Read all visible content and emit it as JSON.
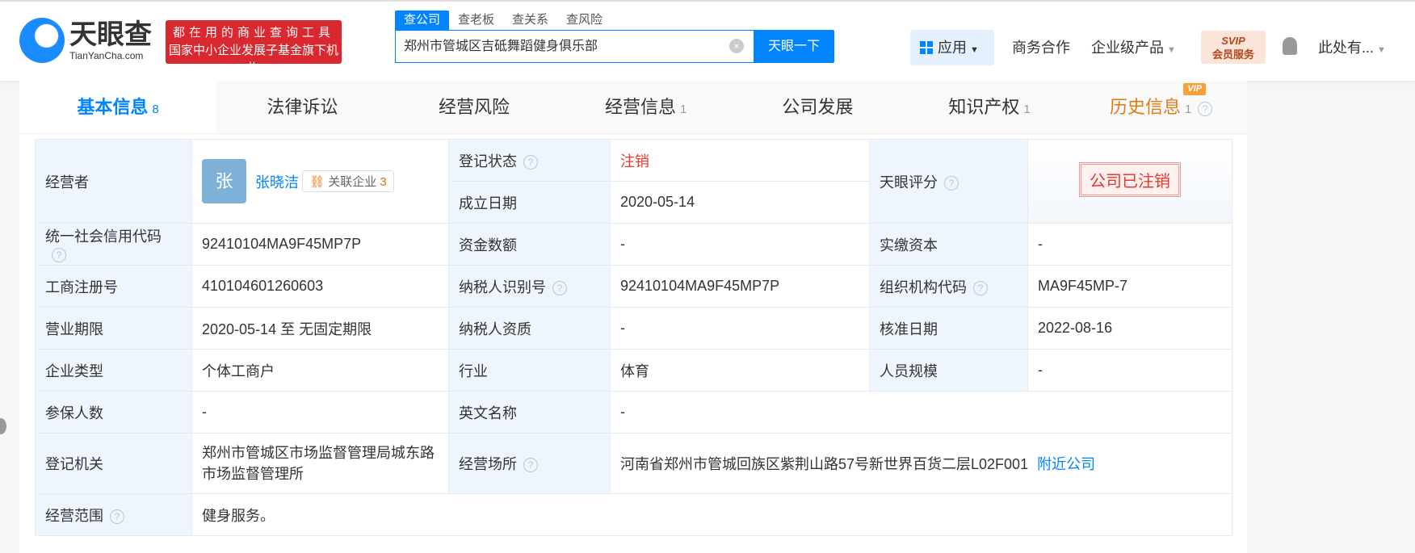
{
  "header": {
    "logo_cn": "天眼查",
    "logo_en": "TianYanCha.com",
    "slogan_line1": "都在用的商业查询工具",
    "slogan_line2": "国家中小企业发展子基金旗下机构",
    "search_tabs": [
      "查公司",
      "查老板",
      "查关系",
      "查风险"
    ],
    "search_value": "郑州市管城区吉砥舞蹈健身俱乐部",
    "search_button": "天眼一下",
    "nav": {
      "app": "应用",
      "business": "商务合作",
      "enterprise": "企业级产品",
      "svip_top": "SVIP",
      "svip_bottom": "会员服务",
      "user": "此处有..."
    }
  },
  "tabs": [
    {
      "label": "基本信息",
      "count": "8"
    },
    {
      "label": "法律诉讼",
      "count": ""
    },
    {
      "label": "经营风险",
      "count": ""
    },
    {
      "label": "经营信息",
      "count": "1"
    },
    {
      "label": "公司发展",
      "count": ""
    },
    {
      "label": "知识产权",
      "count": "1"
    },
    {
      "label": "历史信息",
      "count": "1",
      "badge": "VIP"
    }
  ],
  "info": {
    "operator_label": "经营者",
    "operator_avatar": "张",
    "operator_name": "张晓洁",
    "related_label": "关联企业",
    "related_count": "3",
    "status_label": "登记状态",
    "status_value": "注销",
    "founded_label": "成立日期",
    "founded_value": "2020-05-14",
    "score_label": "天眼评分",
    "score_stamp": "公司已注销",
    "credit_code_label": "统一社会信用代码",
    "credit_code_value": "92410104MA9F45MP7P",
    "capital_label": "资金数额",
    "capital_value": "-",
    "paid_label": "实缴资本",
    "paid_value": "-",
    "reg_no_label": "工商注册号",
    "reg_no_value": "410104601260603",
    "tax_id_label": "纳税人识别号",
    "tax_id_value": "92410104MA9F45MP7P",
    "org_code_label": "组织机构代码",
    "org_code_value": "MA9F45MP-7",
    "term_label": "营业期限",
    "term_value": "2020-05-14 至 无固定期限",
    "taxpayer_label": "纳税人资质",
    "taxpayer_value": "-",
    "approve_label": "核准日期",
    "approve_value": "2022-08-16",
    "type_label": "企业类型",
    "type_value": "个体工商户",
    "industry_label": "行业",
    "industry_value": "体育",
    "staff_label": "人员规模",
    "staff_value": "-",
    "insured_label": "参保人数",
    "insured_value": "-",
    "english_label": "英文名称",
    "english_value": "-",
    "authority_label": "登记机关",
    "authority_value": "郑州市管城区市场监督管理局城东路市场监督管理所",
    "address_label": "经营场所",
    "address_value": "河南省郑州市管城回族区紫荆山路57号新世界百货二层L02F001",
    "nearby": "附近公司",
    "scope_label": "经营范围",
    "scope_value": "健身服务。"
  }
}
